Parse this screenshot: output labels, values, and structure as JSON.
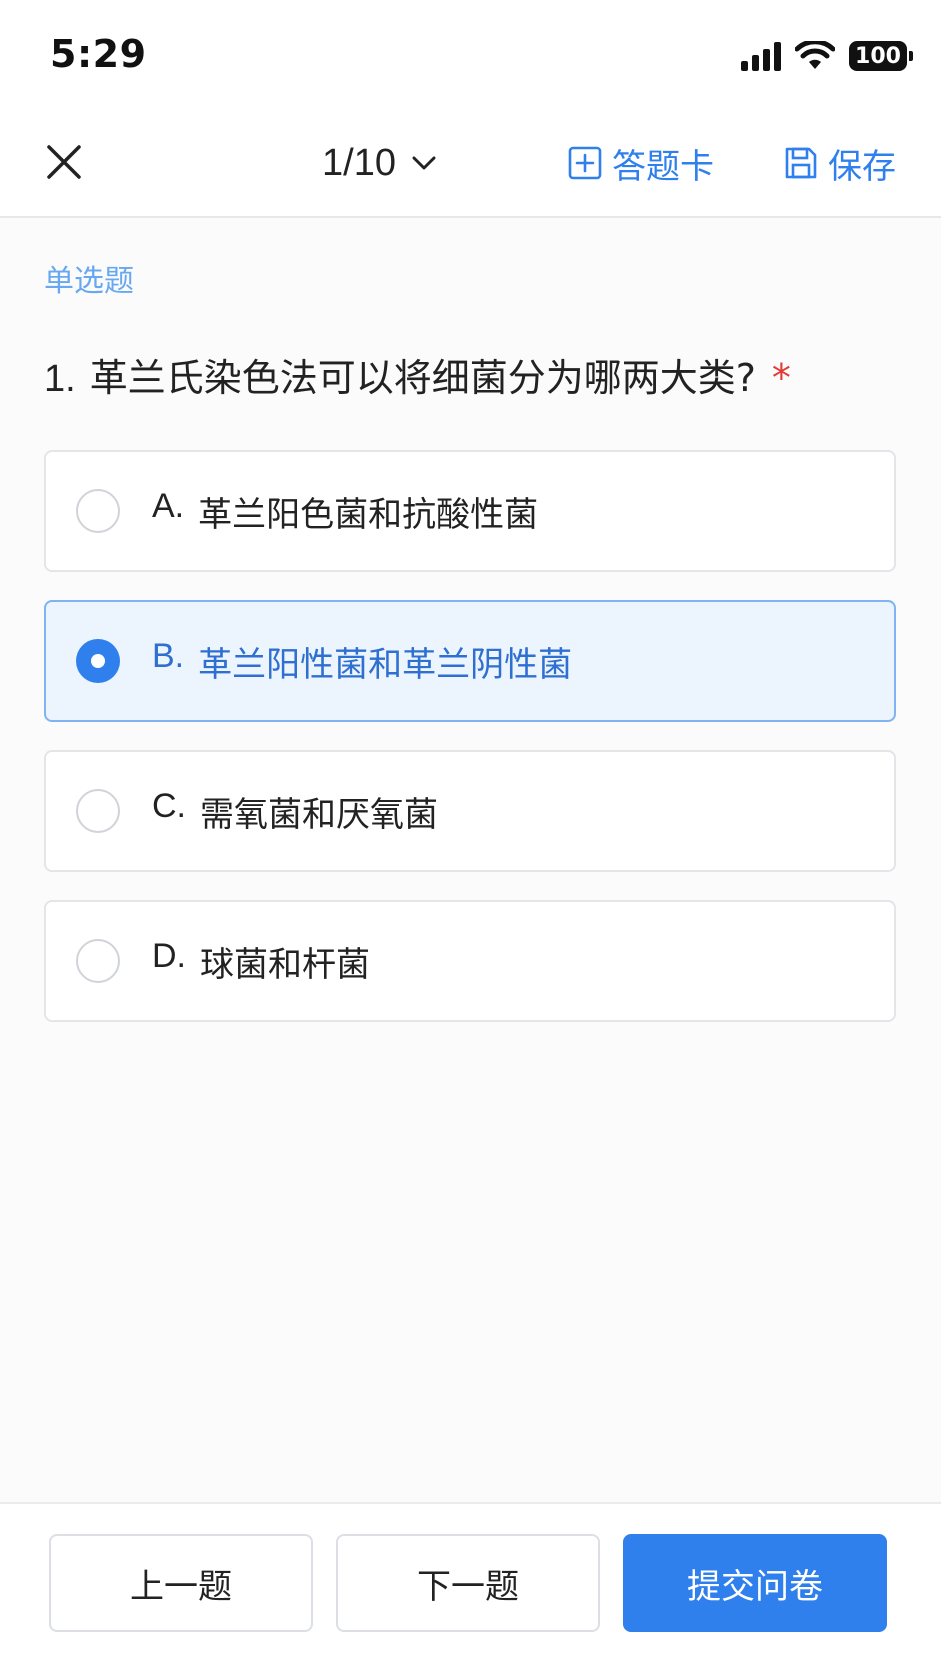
{
  "status_bar": {
    "time": "5:29",
    "battery": "100",
    "icons": [
      "signal-icon",
      "wifi-icon",
      "battery-icon"
    ]
  },
  "header": {
    "close_icon": "close-icon",
    "progress": "1/10",
    "answer_card_label": "答题卡",
    "save_label": "保存",
    "accent_color": "#2f80ed"
  },
  "question": {
    "type_label": "单选题",
    "number": "1.",
    "text": "革兰氏染色法可以将细菌分为哪两大类?",
    "required_mark": "*",
    "options": [
      {
        "letter": "A.",
        "text": "革兰阳色菌和抗酸性菌",
        "selected": false
      },
      {
        "letter": "B.",
        "text": "革兰阳性菌和革兰阴性菌",
        "selected": true
      },
      {
        "letter": "C.",
        "text": "需氧菌和厌氧菌",
        "selected": false
      },
      {
        "letter": "D.",
        "text": "球菌和杆菌",
        "selected": false
      }
    ]
  },
  "footer": {
    "prev_label": "上一题",
    "next_label": "下一题",
    "submit_label": "提交问卷"
  }
}
